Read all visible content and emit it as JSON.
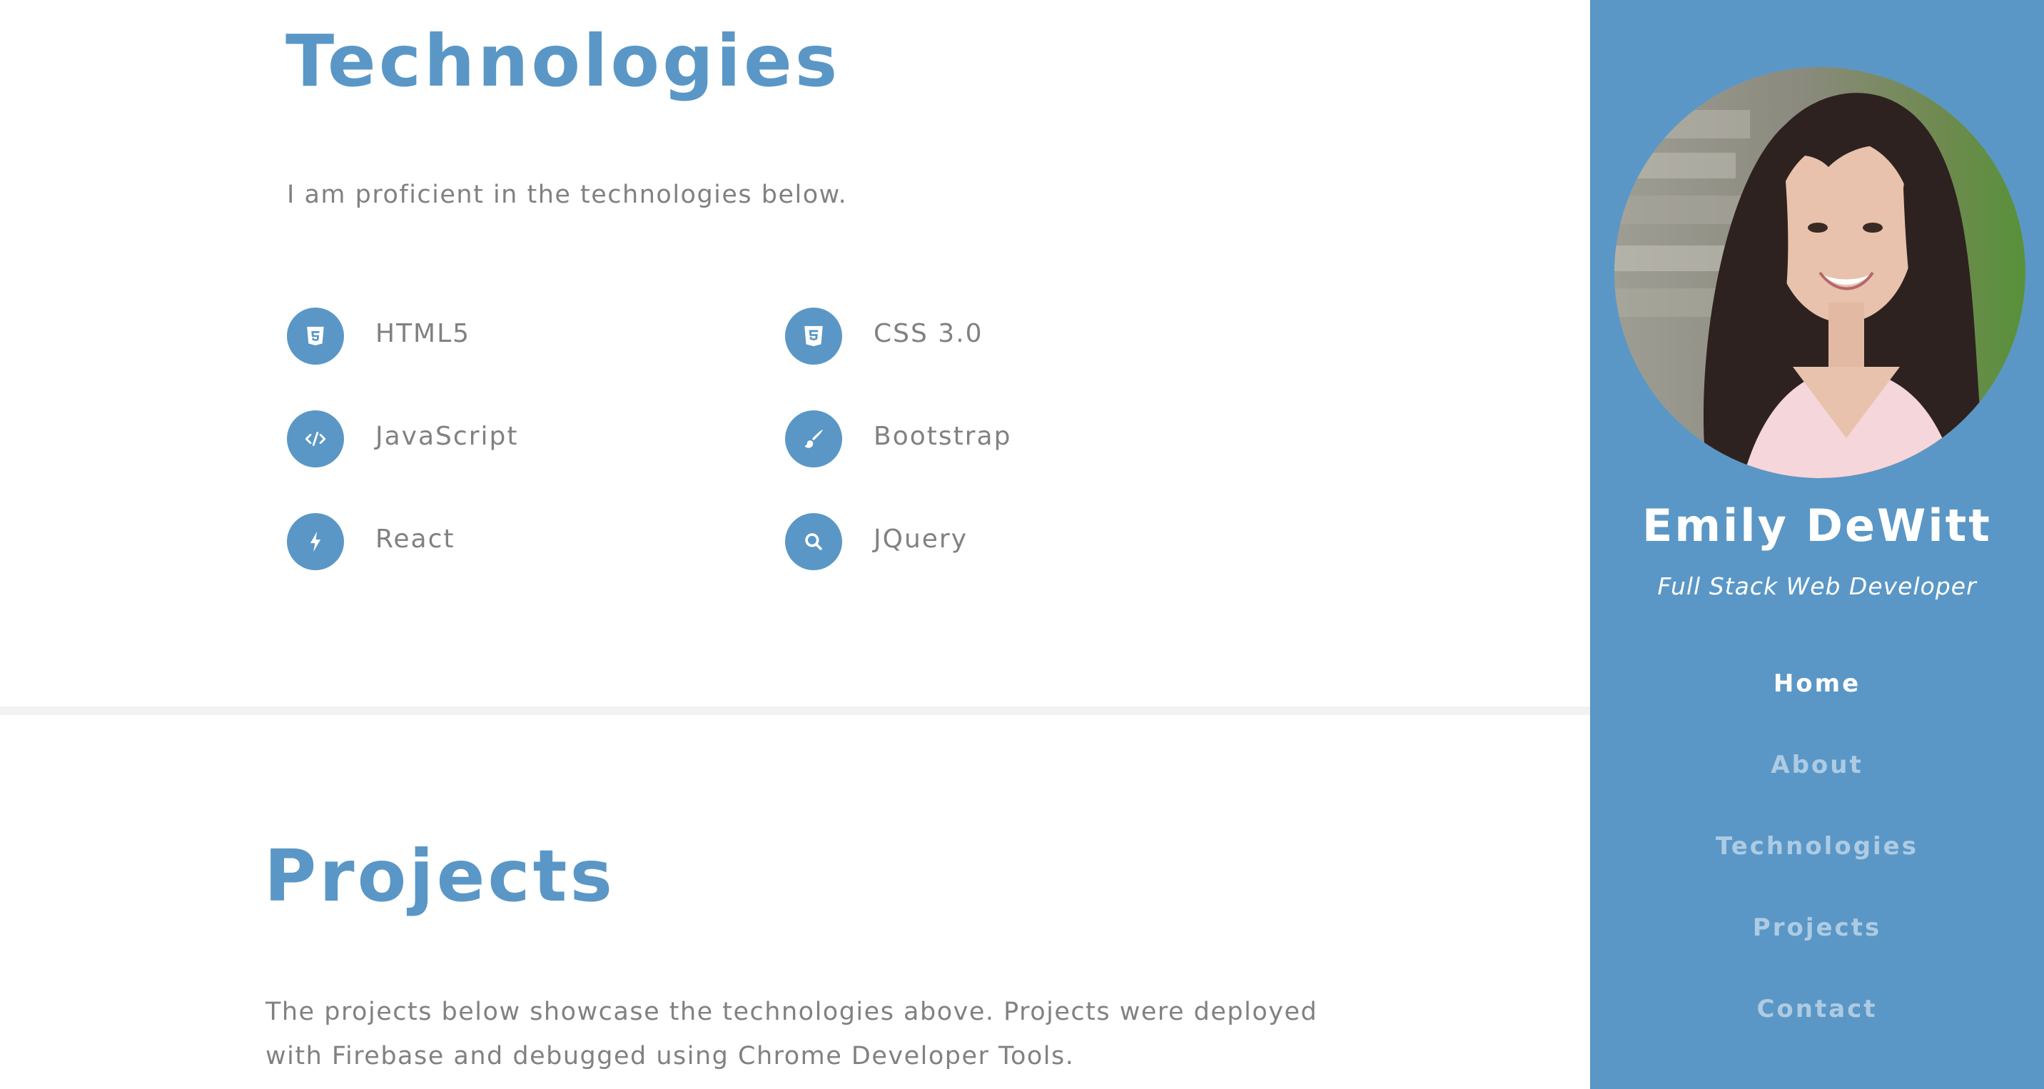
{
  "technologies": {
    "title": "Technologies",
    "description": "I am proficient in the technologies below.",
    "items": [
      {
        "label": "HTML5",
        "icon": "html5-icon"
      },
      {
        "label": "CSS 3.0",
        "icon": "css3-icon"
      },
      {
        "label": "JavaScript",
        "icon": "code-icon"
      },
      {
        "label": "Bootstrap",
        "icon": "paintbrush-icon"
      },
      {
        "label": "React",
        "icon": "bolt-icon"
      },
      {
        "label": "JQuery",
        "icon": "search-icon"
      }
    ]
  },
  "projects": {
    "title": "Projects",
    "description": "The projects below showcase the technologies above. Projects were deployed with Firebase and debugged using Chrome Developer Tools."
  },
  "sidebar": {
    "name": "Emily DeWitt",
    "role": "Full Stack Web Developer",
    "nav": [
      {
        "label": "Home",
        "active": true
      },
      {
        "label": "About",
        "active": false
      },
      {
        "label": "Technologies",
        "active": false
      },
      {
        "label": "Projects",
        "active": false
      },
      {
        "label": "Contact",
        "active": false
      }
    ]
  },
  "colors": {
    "accent": "#5a97c6",
    "text_muted": "#818181",
    "divider": "#f2f2f2"
  }
}
